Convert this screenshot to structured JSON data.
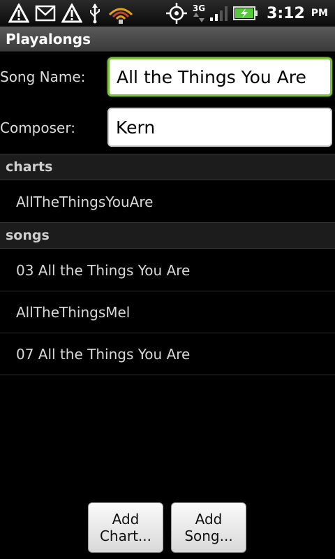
{
  "status_bar": {
    "network": "3G",
    "time": "3:12",
    "ampm": "PM",
    "icons": [
      "warning-icon",
      "gmail-icon",
      "warning-icon",
      "usb-icon",
      "wifi-hotspot-icon",
      "gps-icon",
      "signal-icon",
      "battery-charging-icon"
    ]
  },
  "app": {
    "title": "Playalongs"
  },
  "form": {
    "song_name_label": "Song Name:",
    "song_name_value": "All the Things You Are",
    "composer_label": "Composer:",
    "composer_value": "Kern"
  },
  "sections": {
    "charts": {
      "header": "charts",
      "items": [
        "AllTheThingsYouAre"
      ]
    },
    "songs": {
      "header": "songs",
      "items": [
        "03 All the Things You Are",
        "AllTheThingsMel",
        "07 All the Things You Are"
      ]
    }
  },
  "buttons": {
    "add_chart_line1": "Add",
    "add_chart_line2": "Chart...",
    "add_song_line1": "Add",
    "add_song_line2": "Song..."
  },
  "colors": {
    "focus_border": "#7fc242",
    "battery": "#5ac83c"
  }
}
